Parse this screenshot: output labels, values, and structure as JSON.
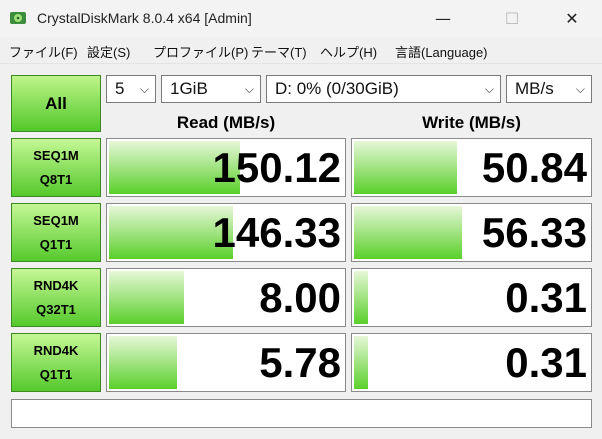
{
  "window": {
    "title": "CrystalDiskMark 8.0.4 x64 [Admin]"
  },
  "window_controls": {
    "minimize": "—",
    "maximize": "☐",
    "close": "✕"
  },
  "menu": [
    "ファイル(F)",
    "設定(S)",
    "プロファイル(P)",
    "テーマ(T)",
    "ヘルプ(H)",
    "言語(Language)"
  ],
  "controls": {
    "all_label": "All",
    "count": "5",
    "size": "1GiB",
    "drive": "D: 0% (0/30GiB)",
    "unit": "MB/s",
    "chevron": "⌵"
  },
  "headers": {
    "read": "Read (MB/s)",
    "write": "Write (MB/s)"
  },
  "colors": {
    "bar_green": "#5ad02a",
    "button_green": "#52c82a"
  },
  "tests": [
    {
      "line1": "SEQ1M",
      "line2": "Q8T1",
      "read": "150.12",
      "write": "50.84",
      "read_fill": 0.56,
      "write_fill": 0.44
    },
    {
      "line1": "SEQ1M",
      "line2": "Q1T1",
      "read": "146.33",
      "write": "56.33",
      "read_fill": 0.53,
      "write_fill": 0.46
    },
    {
      "line1": "RND4K",
      "line2": "Q32T1",
      "read": "8.00",
      "write": "0.31",
      "read_fill": 0.32,
      "write_fill": 0.06
    },
    {
      "line1": "RND4K",
      "line2": "Q1T1",
      "read": "5.78",
      "write": "0.31",
      "read_fill": 0.29,
      "write_fill": 0.06
    }
  ],
  "comment": ""
}
